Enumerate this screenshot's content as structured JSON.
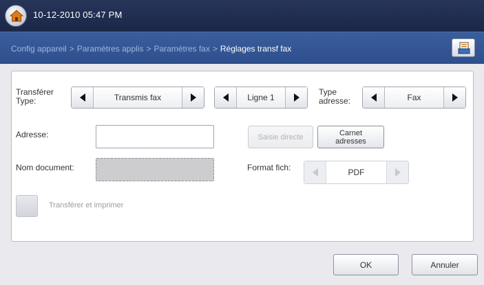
{
  "header": {
    "datetime": "10-12-2010 05:47 PM",
    "home_icon": "home-icon"
  },
  "breadcrumb": {
    "items": [
      "Config appareil",
      "Paramètres applis",
      "Paramètres fax"
    ],
    "current": "Réglages transf fax",
    "separator": ">",
    "quick_button_icon": "job-status-icon"
  },
  "form": {
    "transfer_type": {
      "label_line1": "Transférer",
      "label_line2": "Type:",
      "value": "Transmis fax"
    },
    "line": {
      "value": "Ligne 1"
    },
    "address_type": {
      "label_line1": "Type",
      "label_line2": "adresse:",
      "value": "Fax"
    },
    "address": {
      "label": "Adresse:",
      "value": ""
    },
    "direct_entry_button": "Saisie directe",
    "address_book_button": {
      "line1": "Carnet",
      "line2": "adresses"
    },
    "document_name": {
      "label": "Nom document:",
      "value": ""
    },
    "file_format": {
      "label": "Format fich:",
      "value": "PDF"
    },
    "transfer_and_print": {
      "label": "Transférer et imprimer",
      "checked": false
    }
  },
  "footer": {
    "ok_label": "OK",
    "cancel_label": "Annuler"
  },
  "colors": {
    "topbar": "#1f2b4e",
    "breadcrumb_bar": "#345694",
    "panel": "#ffffff",
    "background": "#e9e9ee"
  }
}
